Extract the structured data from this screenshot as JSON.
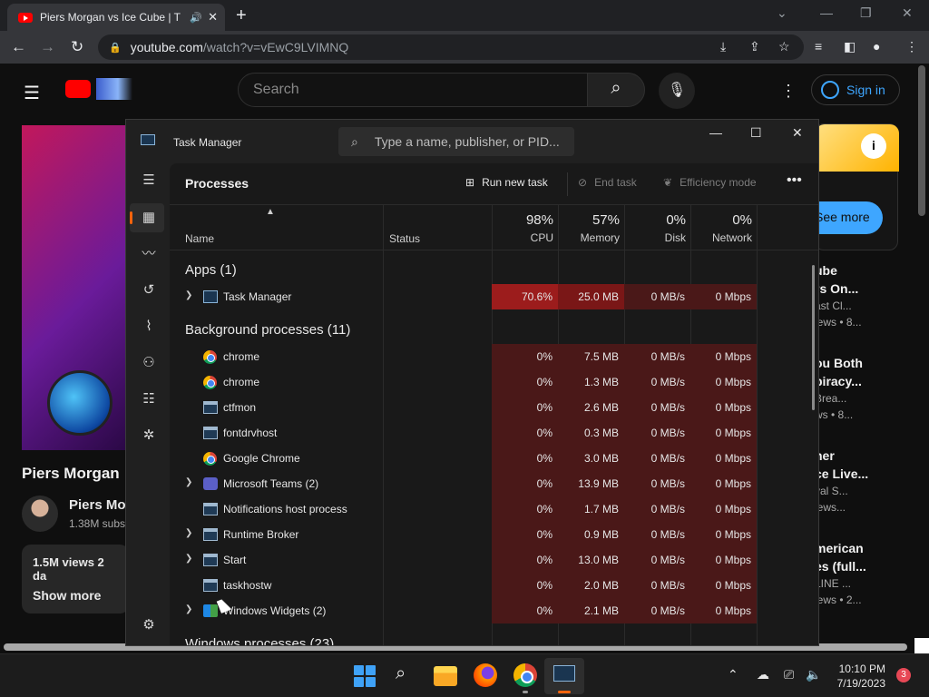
{
  "browser": {
    "tab_title": "Piers Morgan vs Ice Cube | T",
    "url_host": "youtube.com",
    "url_path": "/watch?v=vEwC9LVIMNQ"
  },
  "youtube": {
    "search_placeholder": "Search",
    "signin_label": "Sign in",
    "video_title": "Piers Morgan",
    "channel_name": "Piers Mo",
    "subscribers": "1.38M subs",
    "views": "1.5M views  2 da",
    "show_more": "Show more",
    "ad_button": "See more",
    "recommendations": [
      {
        "title": "ube\nrs On...",
        "channel": "ast Cl...",
        "meta": "iews  • 8..."
      },
      {
        "title": "ou Both\npiracy...",
        "channel": "Brea...",
        "meta": "ws  • 8..."
      },
      {
        "title": "her\nce Live...",
        "channel": "yal S...",
        "meta": "iews..."
      },
      {
        "title": "merican\nes (full...",
        "channel": "LINE ...",
        "meta": "iews  • 2..."
      }
    ]
  },
  "task_manager": {
    "window_title": "Task Manager",
    "search_placeholder": "Type a name, publisher, or PID...",
    "page_title": "Processes",
    "commands": {
      "run_new_task": "Run new task",
      "end_task": "End task",
      "efficiency_mode": "Efficiency mode"
    },
    "columns": {
      "name": "Name",
      "status": "Status",
      "cpu_pct": "98%",
      "cpu": "CPU",
      "memory_pct": "57%",
      "memory": "Memory",
      "disk_pct": "0%",
      "disk": "Disk",
      "network_pct": "0%",
      "network": "Network"
    },
    "groups": {
      "apps": "Apps (1)",
      "background": "Background processes (11)",
      "windows": "Windows processes (23)"
    },
    "apps": [
      {
        "name": "Task Manager",
        "icon": "task-manager-icon",
        "expand": true,
        "cpu": "70.6%",
        "memory": "25.0 MB",
        "disk": "0 MB/s",
        "network": "0 Mbps"
      }
    ],
    "background": [
      {
        "name": "chrome",
        "icon": "chrome-icon",
        "expand": false,
        "cpu": "0%",
        "memory": "7.5 MB",
        "disk": "0 MB/s",
        "network": "0 Mbps"
      },
      {
        "name": "chrome",
        "icon": "chrome-icon",
        "expand": false,
        "cpu": "0%",
        "memory": "1.3 MB",
        "disk": "0 MB/s",
        "network": "0 Mbps"
      },
      {
        "name": "ctfmon",
        "icon": "window-icon",
        "expand": false,
        "cpu": "0%",
        "memory": "2.6 MB",
        "disk": "0 MB/s",
        "network": "0 Mbps"
      },
      {
        "name": "fontdrvhost",
        "icon": "window-icon",
        "expand": false,
        "cpu": "0%",
        "memory": "0.3 MB",
        "disk": "0 MB/s",
        "network": "0 Mbps"
      },
      {
        "name": "Google Chrome",
        "icon": "chrome-icon",
        "expand": false,
        "cpu": "0%",
        "memory": "3.0 MB",
        "disk": "0 MB/s",
        "network": "0 Mbps"
      },
      {
        "name": "Microsoft Teams (2)",
        "icon": "teams-icon",
        "expand": true,
        "cpu": "0%",
        "memory": "13.9 MB",
        "disk": "0 MB/s",
        "network": "0 Mbps"
      },
      {
        "name": "Notifications host process",
        "icon": "window-icon",
        "expand": false,
        "cpu": "0%",
        "memory": "1.7 MB",
        "disk": "0 MB/s",
        "network": "0 Mbps"
      },
      {
        "name": "Runtime Broker",
        "icon": "window-icon",
        "expand": true,
        "cpu": "0%",
        "memory": "0.9 MB",
        "disk": "0 MB/s",
        "network": "0 Mbps"
      },
      {
        "name": "Start",
        "icon": "window-icon",
        "expand": true,
        "cpu": "0%",
        "memory": "13.0 MB",
        "disk": "0 MB/s",
        "network": "0 Mbps"
      },
      {
        "name": "taskhostw",
        "icon": "window-icon",
        "expand": false,
        "cpu": "0%",
        "memory": "2.0 MB",
        "disk": "0 MB/s",
        "network": "0 Mbps"
      },
      {
        "name": "Windows Widgets (2)",
        "icon": "widgets-icon",
        "expand": true,
        "cpu": "0%",
        "memory": "2.1 MB",
        "disk": "0 MB/s",
        "network": "0 Mbps"
      }
    ]
  },
  "taskbar": {
    "time": "10:10 PM",
    "date": "7/19/2023",
    "notification_count": "3"
  },
  "colors": {
    "accent": "#f7630c",
    "cpu_hot": "#9c1c1c",
    "heat": "#4a1818",
    "youtube_blue": "#3ea6ff"
  }
}
